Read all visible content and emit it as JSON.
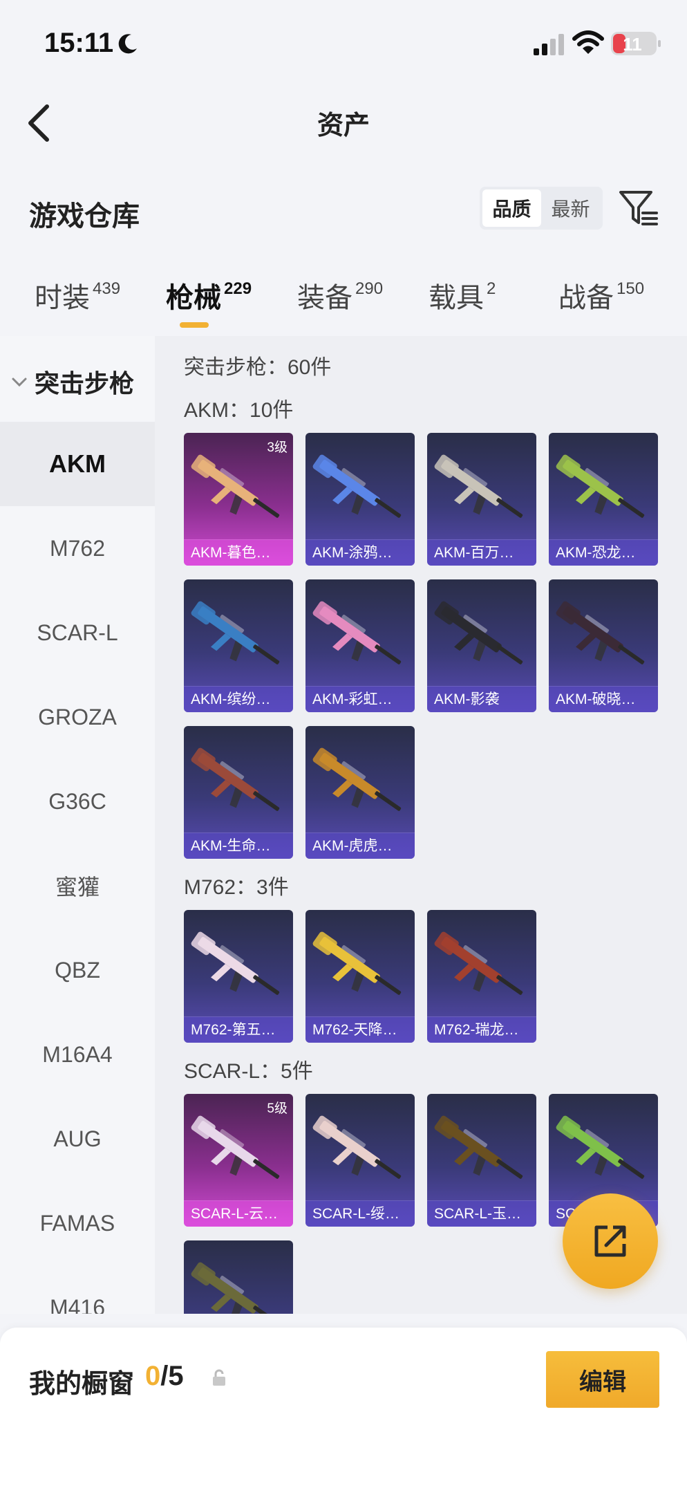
{
  "status_bar": {
    "time": "15:11",
    "battery": "11"
  },
  "nav": {
    "title": "资产"
  },
  "header": {
    "title": "游戏仓库",
    "sort_options": [
      "品质",
      "最新"
    ],
    "active_sort": "品质"
  },
  "tabs": [
    {
      "label": "时装",
      "count": "439"
    },
    {
      "label": "枪械",
      "count": "229"
    },
    {
      "label": "装备",
      "count": "290"
    },
    {
      "label": "载具",
      "count": "2"
    },
    {
      "label": "战备",
      "count": "150"
    }
  ],
  "active_tab": "枪械",
  "sidebar": {
    "category": "突击步枪",
    "items": [
      "AKM",
      "M762",
      "SCAR-L",
      "GROZA",
      "G36C",
      "蜜獾",
      "QBZ",
      "M16A4",
      "AUG",
      "FAMAS",
      "M416"
    ],
    "active_item": "AKM"
  },
  "content": {
    "summary": "突击步枪：60件",
    "groups": [
      {
        "label": "AKM：10件",
        "items": [
          {
            "name": "AKM-暮色…",
            "rarity": "legendary",
            "level": "3级",
            "skin_color": "#e7b27a"
          },
          {
            "name": "AKM-涂鸦…",
            "rarity": "epic",
            "skin_color": "#5b86e8"
          },
          {
            "name": "AKM-百万…",
            "rarity": "epic",
            "skin_color": "#c8c3b8"
          },
          {
            "name": "AKM-恐龙…",
            "rarity": "epic",
            "skin_color": "#9cc24a"
          },
          {
            "name": "AKM-缤纷…",
            "rarity": "epic",
            "skin_color": "#3a7fc4"
          },
          {
            "name": "AKM-彩虹…",
            "rarity": "epic",
            "skin_color": "#e58bbf"
          },
          {
            "name": "AKM-影袭",
            "rarity": "epic",
            "skin_color": "#2a2a30"
          },
          {
            "name": "AKM-破晓…",
            "rarity": "epic",
            "skin_color": "#3b2a36"
          },
          {
            "name": "AKM-生命…",
            "rarity": "epic",
            "skin_color": "#9b4a3a"
          },
          {
            "name": "AKM-虎虎…",
            "rarity": "epic",
            "skin_color": "#c88a2a"
          }
        ]
      },
      {
        "label": "M762：3件",
        "items": [
          {
            "name": "M762-第五…",
            "rarity": "epic",
            "skin_color": "#ecd9e6"
          },
          {
            "name": "M762-天降…",
            "rarity": "epic",
            "skin_color": "#e8c13a"
          },
          {
            "name": "M762-瑞龙…",
            "rarity": "epic",
            "skin_color": "#a2402e"
          }
        ]
      },
      {
        "label": "SCAR-L：5件",
        "items": [
          {
            "name": "SCAR-L-云…",
            "rarity": "legendary",
            "level": "5级",
            "skin_color": "#e8d8ea"
          },
          {
            "name": "SCAR-L-绥…",
            "rarity": "epic",
            "skin_color": "#e9d0cc"
          },
          {
            "name": "SCAR-L-玉…",
            "rarity": "epic",
            "skin_color": "#6a5020"
          },
          {
            "name": "SCAR-L-…",
            "rarity": "epic",
            "skin_color": "#7fc04a"
          },
          {
            "name": "",
            "rarity": "epic",
            "skin_color": "#6b6a3a"
          }
        ]
      }
    ]
  },
  "bottom_bar": {
    "title": "我的橱窗",
    "current": "0",
    "total": "/5",
    "edit_label": "编辑"
  },
  "colors": {
    "accent": "#f2b133",
    "epic_bg": "#3a3a78",
    "legendary_bg": "#8a2f8f"
  }
}
